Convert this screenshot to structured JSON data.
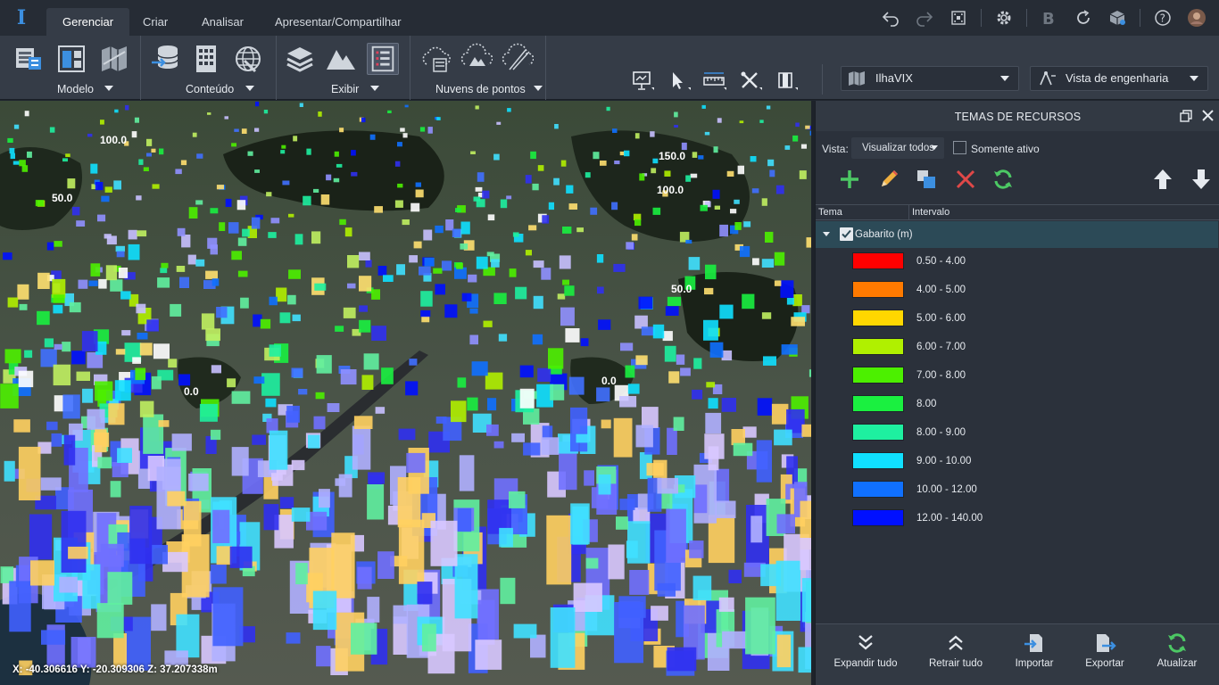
{
  "app": {
    "logo_icon": "app-logo-icon",
    "tabs": [
      {
        "label": "Gerenciar",
        "active": true
      },
      {
        "label": "Criar",
        "active": false
      },
      {
        "label": "Analisar",
        "active": false
      },
      {
        "label": "Apresentar/Compartilhar",
        "active": false
      }
    ],
    "top_icons": [
      "undo-icon",
      "redo-icon",
      "fit-screen-icon",
      "settings-icon",
      "bentley-b-icon",
      "sync-icon",
      "cube-icon",
      "help-icon",
      "user-avatar"
    ],
    "logo_glyph": "I"
  },
  "ribbon": {
    "groups": [
      {
        "label": "Modelo",
        "icons": [
          "model-table-icon",
          "model-layout-icon",
          "model-map-icon"
        ]
      },
      {
        "label": "Conteúdo",
        "icons": [
          "database-import-icon",
          "building-grid-icon",
          "globe-network-icon"
        ]
      },
      {
        "label": "Exibir",
        "icons": [
          "layers-icon",
          "terrain-icon",
          "feature-list-icon"
        ]
      },
      {
        "label": "Nuvens de pontos",
        "icons": [
          "cloud-table-icon",
          "cloud-terrain-icon",
          "cloud-road-icon"
        ]
      }
    ],
    "tools": [
      "presentation-icon",
      "select-arrow-icon",
      "measure-icon",
      "cross-tools-icon",
      "clip-icon"
    ],
    "project_dropdown": "IlhaVIX",
    "view_dropdown": "Vista de engenharia"
  },
  "map": {
    "coordinates": "X: -40.306616 Y: -20.309306 Z: 37.207338m",
    "contour_labels": [
      "100.0",
      "50.0",
      "150.0",
      "100.0",
      "0.0",
      "0.0",
      "50.0"
    ]
  },
  "panel": {
    "title": "TEMAS DE RECURSOS",
    "vista_label": "Vista:",
    "vista_value": "Visualizar todos",
    "only_active_label": "Somente ativo",
    "only_active_checked": false,
    "actions": [
      "add-icon",
      "edit-icon",
      "duplicate-icon",
      "delete-icon",
      "refresh-icon",
      "move-up-icon",
      "move-down-icon"
    ],
    "columns": {
      "theme": "Tema",
      "range": "Intervalo"
    },
    "group": {
      "label": "Gabarito (m)",
      "checked": true,
      "expanded": true
    },
    "legend": [
      {
        "label": "0.50 - 4.00",
        "color": "#ff0000"
      },
      {
        "label": "4.00 - 5.00",
        "color": "#ff7a00"
      },
      {
        "label": "5.00 - 6.00",
        "color": "#ffd700"
      },
      {
        "label": "6.00 - 7.00",
        "color": "#b0f000"
      },
      {
        "label": "7.00 - 8.00",
        "color": "#4cf000"
      },
      {
        "label": "8.00",
        "color": "#1af040"
      },
      {
        "label": "8.00 - 9.00",
        "color": "#1ef0a0"
      },
      {
        "label": "9.00 - 10.00",
        "color": "#10e0ff"
      },
      {
        "label": "10.00 - 12.00",
        "color": "#1070ff"
      },
      {
        "label": "12.00 - 140.00",
        "color": "#0010ff"
      }
    ],
    "footer": [
      {
        "label": "Expandir tudo",
        "icon": "expand-all-icon"
      },
      {
        "label": "Retrair tudo",
        "icon": "collapse-all-icon"
      },
      {
        "label": "Importar",
        "icon": "import-icon"
      },
      {
        "label": "Exportar",
        "icon": "export-icon"
      },
      {
        "label": "Atualizar",
        "icon": "update-icon"
      }
    ]
  }
}
